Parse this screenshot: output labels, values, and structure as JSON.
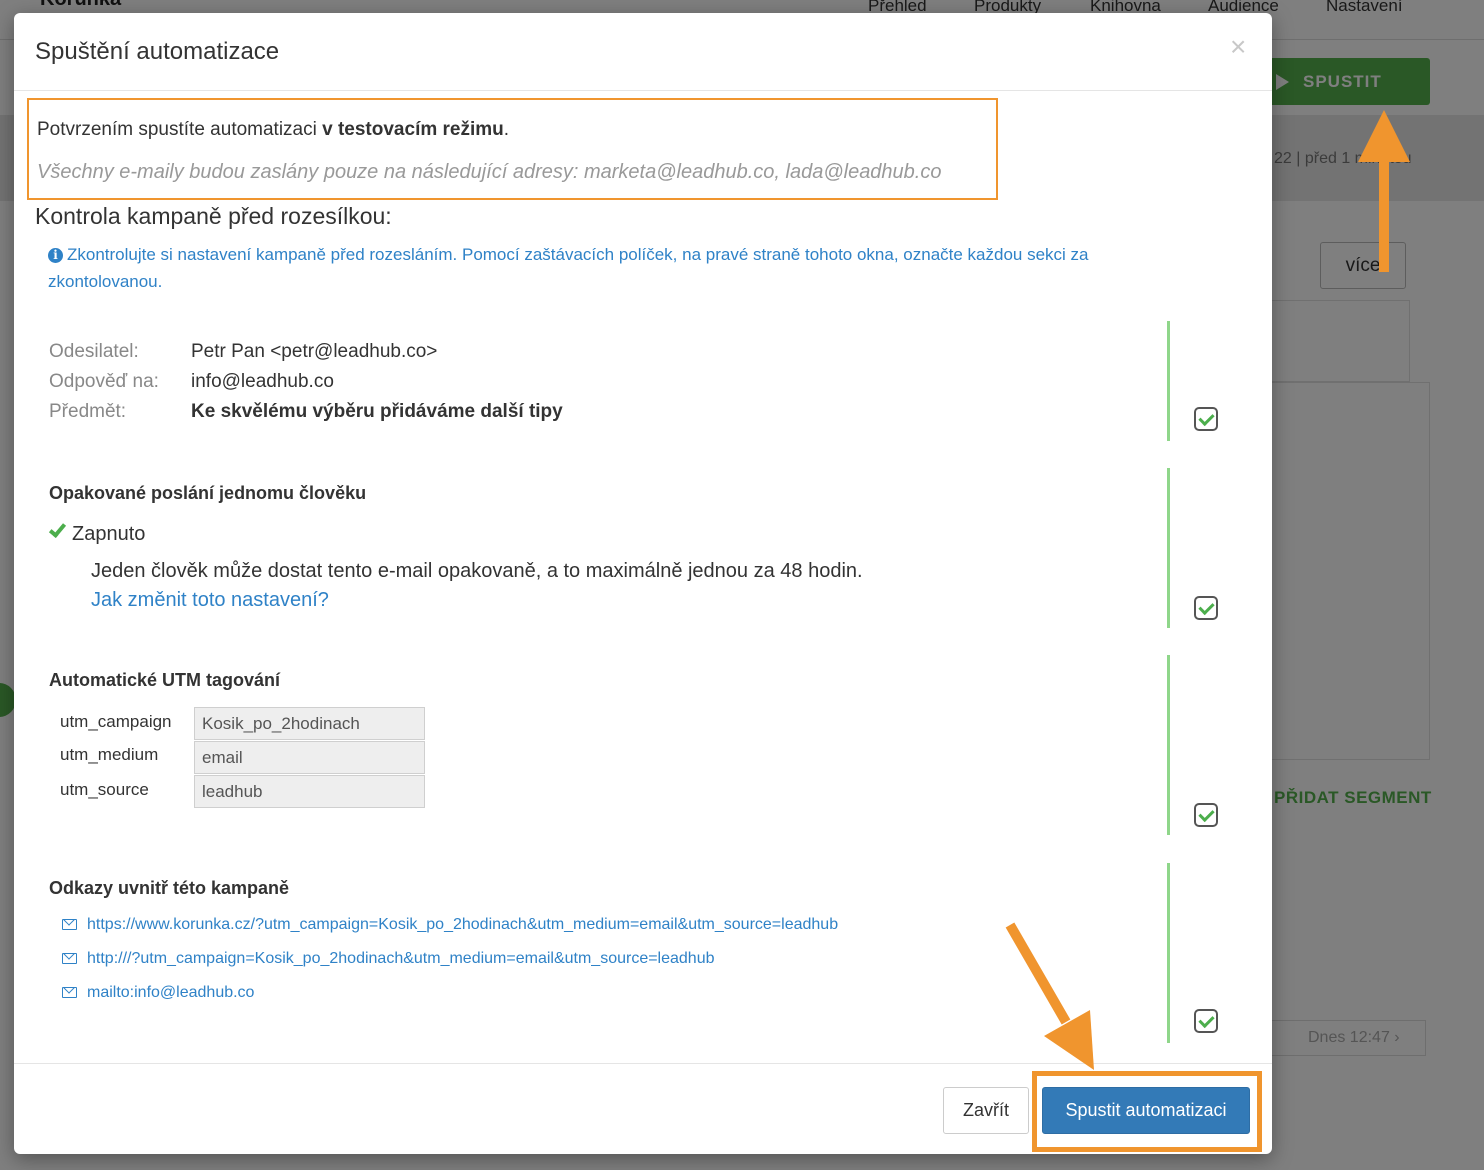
{
  "background": {
    "brand": "Korunka",
    "nav": [
      "Přehled",
      "Produkty",
      "Knihovna",
      "Audience",
      "Nastavení"
    ],
    "spustit_label": "SPUSTIT",
    "meta": "22 | před 1 minutou",
    "vice_label": "více",
    "segment_label": "PŘIDAT SEGMENT",
    "dnes_label": "Dnes 12:47 ›"
  },
  "modal": {
    "title": "Spuštění automatizace",
    "close_symbol": "×",
    "test_notice": {
      "prefix": "Potvrzením spustíte automatizaci ",
      "emphasis": "v testovacím režimu",
      "suffix": ".",
      "addresses_note": "Všechny e-maily budou zaslány pouze na následující adresy: marketa@leadhub.co, lada@leadhub.co"
    },
    "check_title": "Kontrola kampaně před rozesílkou:",
    "info_text": "Zkontrolujte si nastavení kampaně před rozesláním. Pomocí zaštávacích políček, na pravé straně tohoto okna, označte každou sekci za zkontolovanou.",
    "sender": {
      "labels": {
        "from": "Odesilatel:",
        "reply": "Odpověď na:",
        "subject": "Předmět:"
      },
      "values": {
        "from": "Petr Pan <petr@leadhub.co>",
        "reply": "info@leadhub.co",
        "subject": "Ke skvělému výběru přidáváme další tipy"
      }
    },
    "repeat": {
      "title": "Opakované poslání jednomu člověku",
      "status": "Zapnuto",
      "description": "Jeden člověk může dostat tento e-mail opakovaně, a to maximálně jednou za 48 hodin.",
      "link": "Jak změnit toto nastavení?"
    },
    "utm": {
      "title": "Automatické UTM tagování",
      "rows": [
        {
          "label": "utm_campaign",
          "value": "Kosik_po_2hodinach"
        },
        {
          "label": "utm_medium",
          "value": "email"
        },
        {
          "label": "utm_source",
          "value": "leadhub"
        }
      ]
    },
    "links": {
      "title": "Odkazy uvnitř této kampaně",
      "items": [
        "https://www.korunka.cz/?utm_campaign=Kosik_po_2hodinach&utm_medium=email&utm_source=leadhub",
        "http:///?utm_campaign=Kosik_po_2hodinach&utm_medium=email&utm_source=leadhub",
        "mailto:info@leadhub.co"
      ]
    },
    "footer": {
      "close_label": "Zavřít",
      "run_label": "Spustit automatizaci"
    }
  },
  "colors": {
    "accent_blue": "#337ab7",
    "annotation_orange": "#f0952e",
    "check_green": "#4cae4c",
    "spustit_green": "#55b04d"
  }
}
